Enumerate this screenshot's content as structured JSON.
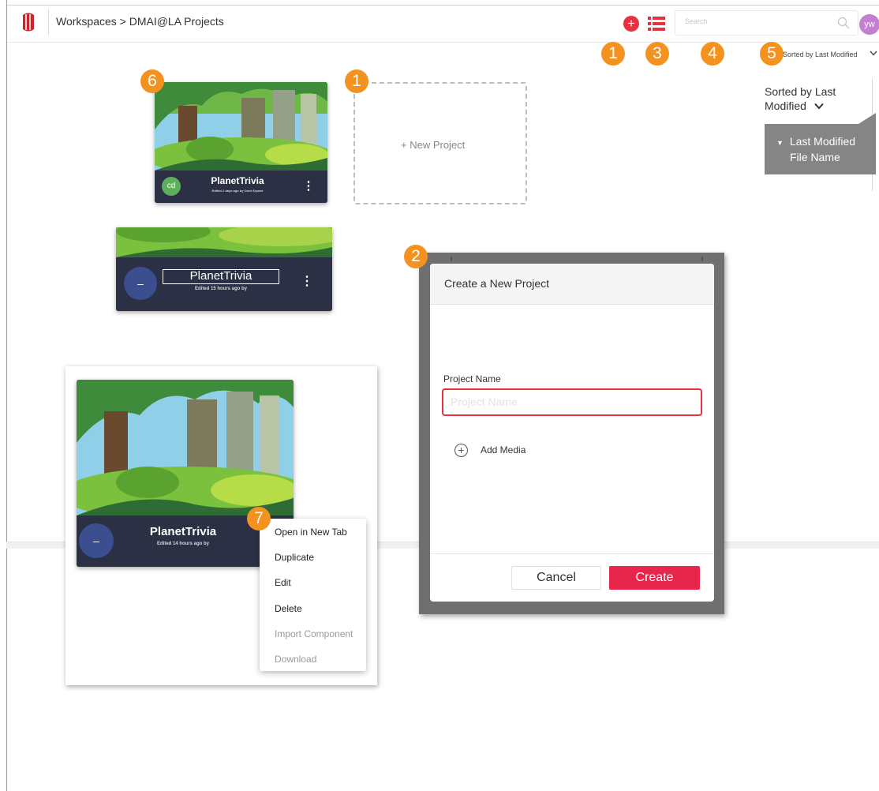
{
  "header": {
    "breadcrumb": "Workspaces > DMAI@LA Projects",
    "add_button": "+",
    "search_placeholder": "Search",
    "user_initials": "yw"
  },
  "markers": {
    "add": "1",
    "list": "3",
    "search": "4",
    "sort": "5",
    "card": "6",
    "new_project": "1",
    "dialog": "2",
    "menu": "7"
  },
  "sort": {
    "label": "Sorted by Last Modified",
    "panel_title": "Sorted by Last Modified",
    "options": [
      "Last Modified",
      "File Name"
    ]
  },
  "projects": {
    "card_main": {
      "title": "PlanetTrivia",
      "subtitle": "Edited 2 days ago by Carol Dysart",
      "avatar": "cd"
    },
    "card_edit": {
      "title": "PlanetTrivia",
      "subtitle": "Edited 15 hours ago by",
      "avatar": "–"
    },
    "card_menu": {
      "title": "PlanetTrivia",
      "subtitle": "Edited 14 hours ago by",
      "avatar": "–"
    },
    "kebab": "⋮"
  },
  "new_project": {
    "label": "+   New Project"
  },
  "context_menu": {
    "items": [
      "Open in New Tab",
      "Duplicate",
      "Edit",
      "Delete",
      "Import Component",
      "Download"
    ]
  },
  "dialog": {
    "title": "Create a New Project",
    "field_label": "Project Name",
    "field_placeholder": "Project Name",
    "add_media_icon": "+",
    "add_media": "Add Media",
    "cancel": "Cancel",
    "create": "Create"
  },
  "colors": {
    "accent_red": "#e8313f",
    "marker_orange": "#f3921e",
    "card_footer": "#2b3044",
    "sort_dropdown": "#858585"
  }
}
